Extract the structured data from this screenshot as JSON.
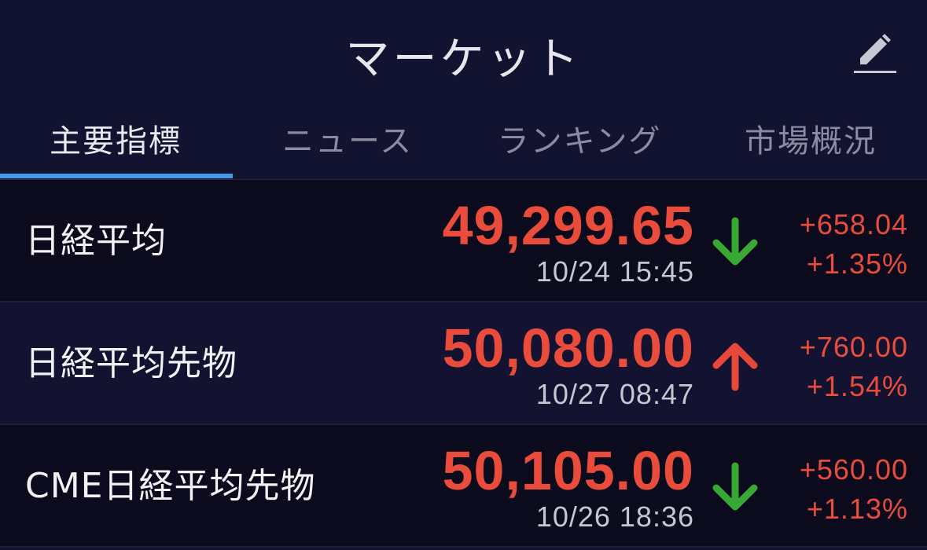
{
  "header": {
    "title": "マーケット",
    "edit_icon": "pencil-icon"
  },
  "tabs": [
    {
      "label": "主要指標",
      "active": true
    },
    {
      "label": "ニュース",
      "active": false
    },
    {
      "label": "ランキング",
      "active": false
    },
    {
      "label": "市場概況",
      "active": false
    }
  ],
  "colors": {
    "background": "#121231",
    "accent_tab": "#3d9be8",
    "price_red": "#ea4c3c",
    "arrow_down_green": "#37a833",
    "arrow_up_red": "#e6483a"
  },
  "rows": [
    {
      "name": "日経平均",
      "price": "49,299.65",
      "datetime": "10/24 15:45",
      "arrow": "down-arrow-icon",
      "change": "+658.04",
      "change_pct": "+1.35%"
    },
    {
      "name": "日経平均先物",
      "price": "50,080.00",
      "datetime": "10/27 08:47",
      "arrow": "up-arrow-icon",
      "change": "+760.00",
      "change_pct": "+1.54%"
    },
    {
      "name": "CME日経平均先物",
      "price": "50,105.00",
      "datetime": "10/26 18:36",
      "arrow": "down-arrow-icon",
      "change": "+560.00",
      "change_pct": "+1.13%"
    }
  ]
}
